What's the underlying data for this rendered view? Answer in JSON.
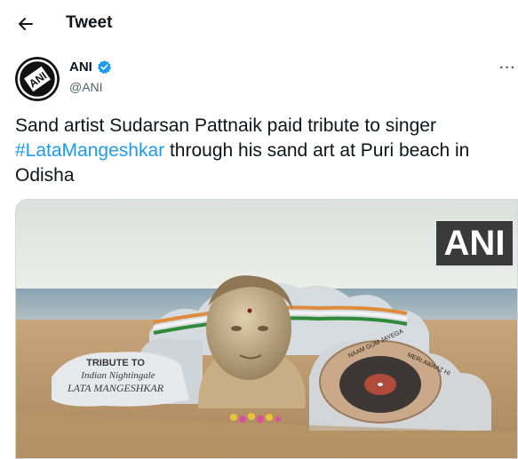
{
  "header": {
    "title": "Tweet",
    "back_icon": "arrow-left-icon"
  },
  "author": {
    "name": "ANI",
    "handle": "@ANI",
    "avatar_text": "ANI",
    "verified_icon": "verified-badge-icon",
    "verified_color": "#1d9bf0"
  },
  "menu": {
    "more_label": "···",
    "icon": "more-horizontal-icon"
  },
  "tweet": {
    "text_before": "Sand artist Sudarsan Pattnaik paid tribute to singer ",
    "hashtag": "#LataMangeshkar",
    "text_after": " through his sand art at Puri beach in Odisha"
  },
  "media": {
    "watermark": "ANI",
    "sculpture_line1": "TRIBUTE TO",
    "sculpture_line2": "Indian Nightingale",
    "sculpture_line3": "LATA MANGESHKAR",
    "record_text_left": "NAAM GUM JAYEGA",
    "record_text_right": "MERI AWAAZ HI"
  },
  "colors": {
    "hashtag": "#1d9bf0",
    "text": "#0f1419",
    "secondary": "#536471"
  }
}
